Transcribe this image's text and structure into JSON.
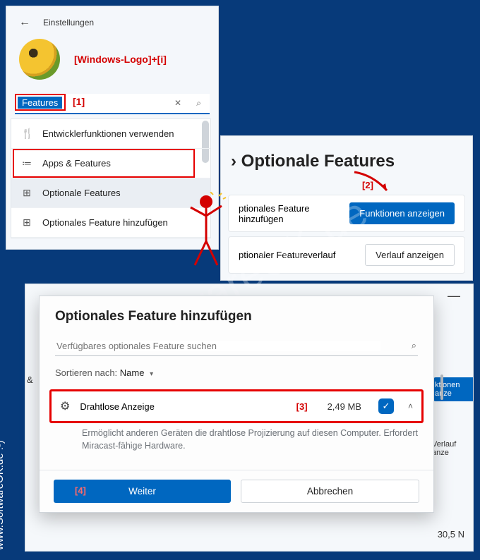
{
  "panel1": {
    "title": "Einstellungen",
    "shortcut": "[Windows-Logo]+[i]",
    "search_value": "Features",
    "anno1": "[1]",
    "results": [
      {
        "icon": "🍴",
        "label": "Entwicklerfunktionen verwenden"
      },
      {
        "icon": "≔",
        "label": "Apps & Features",
        "red": true
      },
      {
        "icon": "⊞",
        "label": "Optionale Features",
        "selected": true
      },
      {
        "icon": "⊞",
        "label": "Optionales Feature hinzufügen"
      }
    ]
  },
  "panel2": {
    "breadcrumb_sep": "›",
    "breadcrumb_right": "Optionale Features",
    "anno2": "[2]",
    "row1_label": "ptionales Feature hinzufügen",
    "row1_btn": "Funktionen anzeigen",
    "row2_label": "ptionaler Featureverlauf",
    "row2_btn": "Verlauf anzeigen"
  },
  "panel3": {
    "title": "Optionales Feature hinzufügen",
    "search_placeholder": "Verfügbares optionales Feature suchen",
    "sort_label": "Sortieren nach:",
    "sort_value": "Name",
    "item_name": "Drahtlose Anzeige",
    "anno3": "[3]",
    "item_size": "2,49 MB",
    "item_desc": "Ermöglicht anderen Geräten die drahtlose Projizierung auf diesen Computer. Erfordert Miracast-fähige Hardware.",
    "btn_next": "Weiter",
    "anno4": "[4]",
    "btn_cancel": "Abbrechen"
  },
  "bg": {
    "left_frag": "&",
    "right_btn1": "ktionen anze",
    "right_btn2": "Verlauf anze",
    "size_frag": "30,5 N"
  },
  "watermark": "SoftwareOK.de",
  "side_text": "www.SoftwareOK.de :-)"
}
